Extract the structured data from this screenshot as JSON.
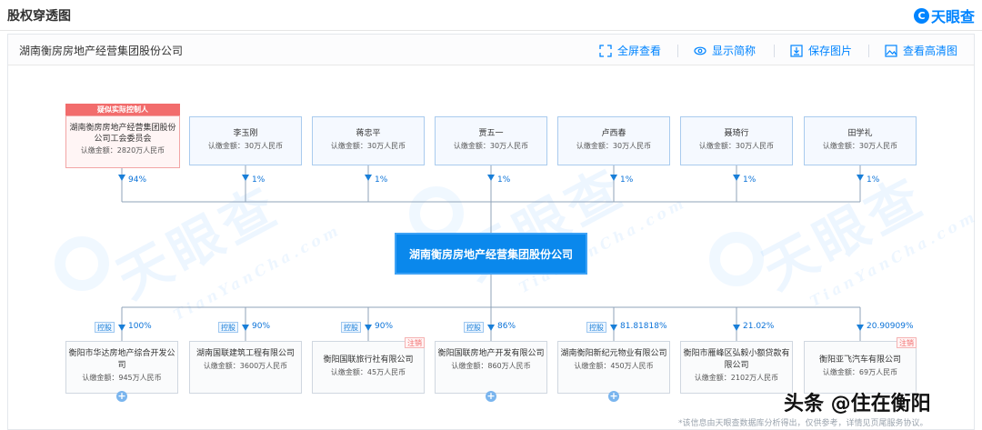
{
  "page": {
    "title": "股权穿透图",
    "brand": "天眼查",
    "brand_logo_char": "C"
  },
  "toolbar": {
    "company_name": "湖南衡房房地产经营集团股份公司",
    "fullscreen": "全屏查看",
    "show_short": "显示简称",
    "save_image": "保存图片",
    "view_hd": "查看高清图"
  },
  "watermark": {
    "big": "天眼查",
    "small": "TianYanCha.com"
  },
  "controller_tag": "疑似实际控制人",
  "shareholders": [
    {
      "name": "湖南衡房房地产经营集团股份公司工会委员会",
      "amount": "认缴金额：2820万人民币",
      "pct": "94%",
      "is_controller": true
    },
    {
      "name": "李玉刚",
      "amount": "认缴金额：30万人民币",
      "pct": "1%"
    },
    {
      "name": "蒋忠平",
      "amount": "认缴金额：30万人民币",
      "pct": "1%"
    },
    {
      "name": "贾五一",
      "amount": "认缴金额：30万人民币",
      "pct": "1%"
    },
    {
      "name": "卢西春",
      "amount": "认缴金额：30万人民币",
      "pct": "1%"
    },
    {
      "name": "聂琦行",
      "amount": "认缴金额：30万人民币",
      "pct": "1%"
    },
    {
      "name": "田学礼",
      "amount": "认缴金额：30万人民币",
      "pct": "1%"
    }
  ],
  "center": {
    "name": "湖南衡房房地产经营集团股份公司"
  },
  "subsidiaries": [
    {
      "name": "衡阳市华达房地产综合开发公司",
      "amount": "认缴金额：945万人民币",
      "pct": "100%",
      "badge": "控股",
      "status": "",
      "expandable": true
    },
    {
      "name": "湖南国联建筑工程有限公司",
      "amount": "认缴金额：3600万人民币",
      "pct": "90%",
      "badge": "控股",
      "status": "",
      "expandable": false
    },
    {
      "name": "衡阳国联旅行社有限公司",
      "amount": "认缴金额：45万人民币",
      "pct": "90%",
      "badge": "控股",
      "status": "注销",
      "expandable": false
    },
    {
      "name": "衡阳国联房地产开发有限公司",
      "amount": "认缴金额：860万人民币",
      "pct": "86%",
      "badge": "控股",
      "status": "",
      "expandable": true
    },
    {
      "name": "湖南衡阳新纪元物业有限公司",
      "amount": "认缴金额：450万人民币",
      "pct": "81.81818%",
      "badge": "控股",
      "status": "",
      "expandable": true
    },
    {
      "name": "衡阳市雁峰区弘毅小额贷款有限公司",
      "amount": "认缴金额：2102万人民币",
      "pct": "21.02%",
      "badge": "",
      "status": "",
      "expandable": false
    },
    {
      "name": "衡阳亚飞汽车有限公司",
      "amount": "认缴金额：69万人民币",
      "pct": "20.90909%",
      "badge": "",
      "status": "注销",
      "expandable": false
    }
  ],
  "expand_symbol": "+",
  "disclaimer": "*该信息由天眼查数据库分析得出，仅供参考，详情见页尾服务协议。",
  "signature": "头条 @住在衡阳",
  "colors": {
    "accent": "#0084ff",
    "center_fill": "#0a88ec",
    "controller_tag": "#f26c6c",
    "status_cancelled": "#f26c6c"
  }
}
